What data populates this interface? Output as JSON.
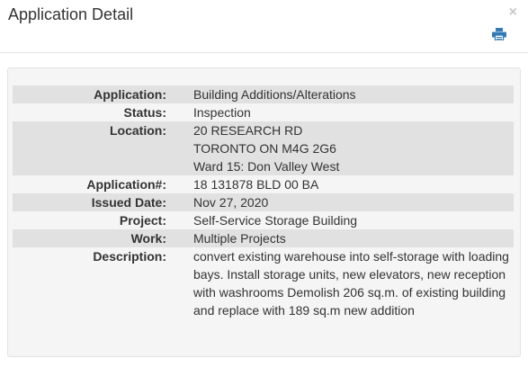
{
  "dialog": {
    "title": "Application Detail",
    "close_glyph": "×",
    "print_icon": "printer-icon",
    "colors": {
      "row_shade": "#e1e1e1",
      "panel_bg": "#f5f5f5",
      "icon": "#337ab7"
    }
  },
  "details": {
    "application": {
      "label": "Application:",
      "value": "Building Additions/Alterations"
    },
    "status": {
      "label": "Status:",
      "value": "Inspection"
    },
    "location": {
      "label": "Location:",
      "line1": "20 RESEARCH RD",
      "line2": "TORONTO ON M4G 2G6",
      "line3": "Ward 15: Don Valley West"
    },
    "application_number": {
      "label": "Application#:",
      "value": "18 131878 BLD 00 BA"
    },
    "issued_date": {
      "label": "Issued Date:",
      "value": "Nov 27, 2020"
    },
    "project": {
      "label": "Project:",
      "value": "Self-Service Storage Building"
    },
    "work": {
      "label": "Work:",
      "value": "Multiple Projects"
    },
    "description": {
      "label": "Description:",
      "value": "convert existing warehouse into self-storage with loading bays. Install storage units, new elevators, new reception with washrooms Demolish 206 sq.m. of existing building and replace with 189 sq.m new addition"
    }
  }
}
